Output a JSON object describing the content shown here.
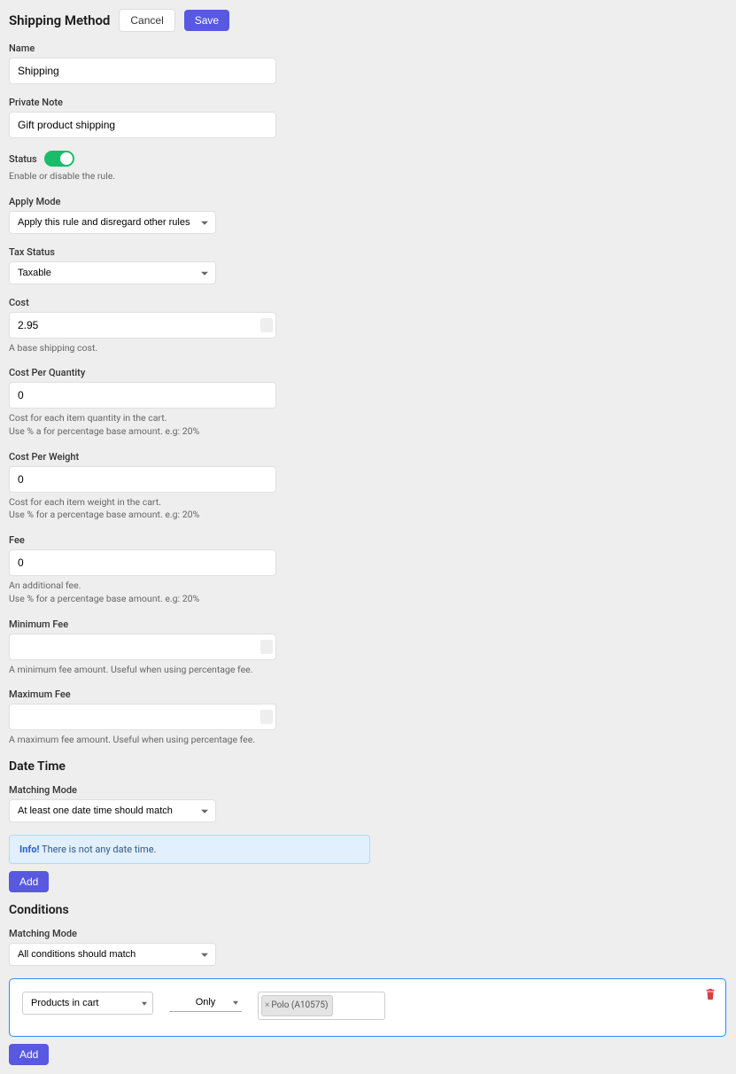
{
  "header": {
    "title": "Shipping Method",
    "cancel": "Cancel",
    "save": "Save"
  },
  "name": {
    "label": "Name",
    "value": "Shipping"
  },
  "privateNote": {
    "label": "Private Note",
    "value": "Gift product shipping"
  },
  "status": {
    "label": "Status",
    "help": "Enable or disable the rule."
  },
  "applyMode": {
    "label": "Apply Mode",
    "value": "Apply this rule and disregard other rules"
  },
  "taxStatus": {
    "label": "Tax Status",
    "value": "Taxable"
  },
  "cost": {
    "label": "Cost",
    "value": "2.95",
    "help": "A base shipping cost."
  },
  "costPerQuantity": {
    "label": "Cost Per Quantity",
    "value": "0",
    "help1": "Cost for each item quantity in the cart.",
    "help2": "Use % a for percentage base amount. e.g: 20%"
  },
  "costPerWeight": {
    "label": "Cost Per Weight",
    "value": "0",
    "help1": "Cost for each item weight in the cart.",
    "help2": "Use % for a percentage base amount. e.g: 20%"
  },
  "fee": {
    "label": "Fee",
    "value": "0",
    "help1": "An additional fee.",
    "help2": "Use % for a percentage base amount. e.g: 20%"
  },
  "minimumFee": {
    "label": "Minimum Fee",
    "value": "",
    "help": "A minimum fee amount. Useful when using percentage fee."
  },
  "maximumFee": {
    "label": "Maximum Fee",
    "value": "",
    "help": "A maximum fee amount. Useful when using percentage fee."
  },
  "dateTime": {
    "title": "Date Time",
    "matchingMode": {
      "label": "Matching Mode",
      "value": "At least one date time should match"
    },
    "infoLabel": "Info!",
    "infoText": "There is not any date time.",
    "add": "Add"
  },
  "conditions": {
    "title": "Conditions",
    "matchingMode": {
      "label": "Matching Mode",
      "value": "All conditions should match"
    },
    "row": {
      "type": "Products in cart",
      "mode": "Only",
      "tag": "Polo (A10575)"
    },
    "add": "Add"
  }
}
